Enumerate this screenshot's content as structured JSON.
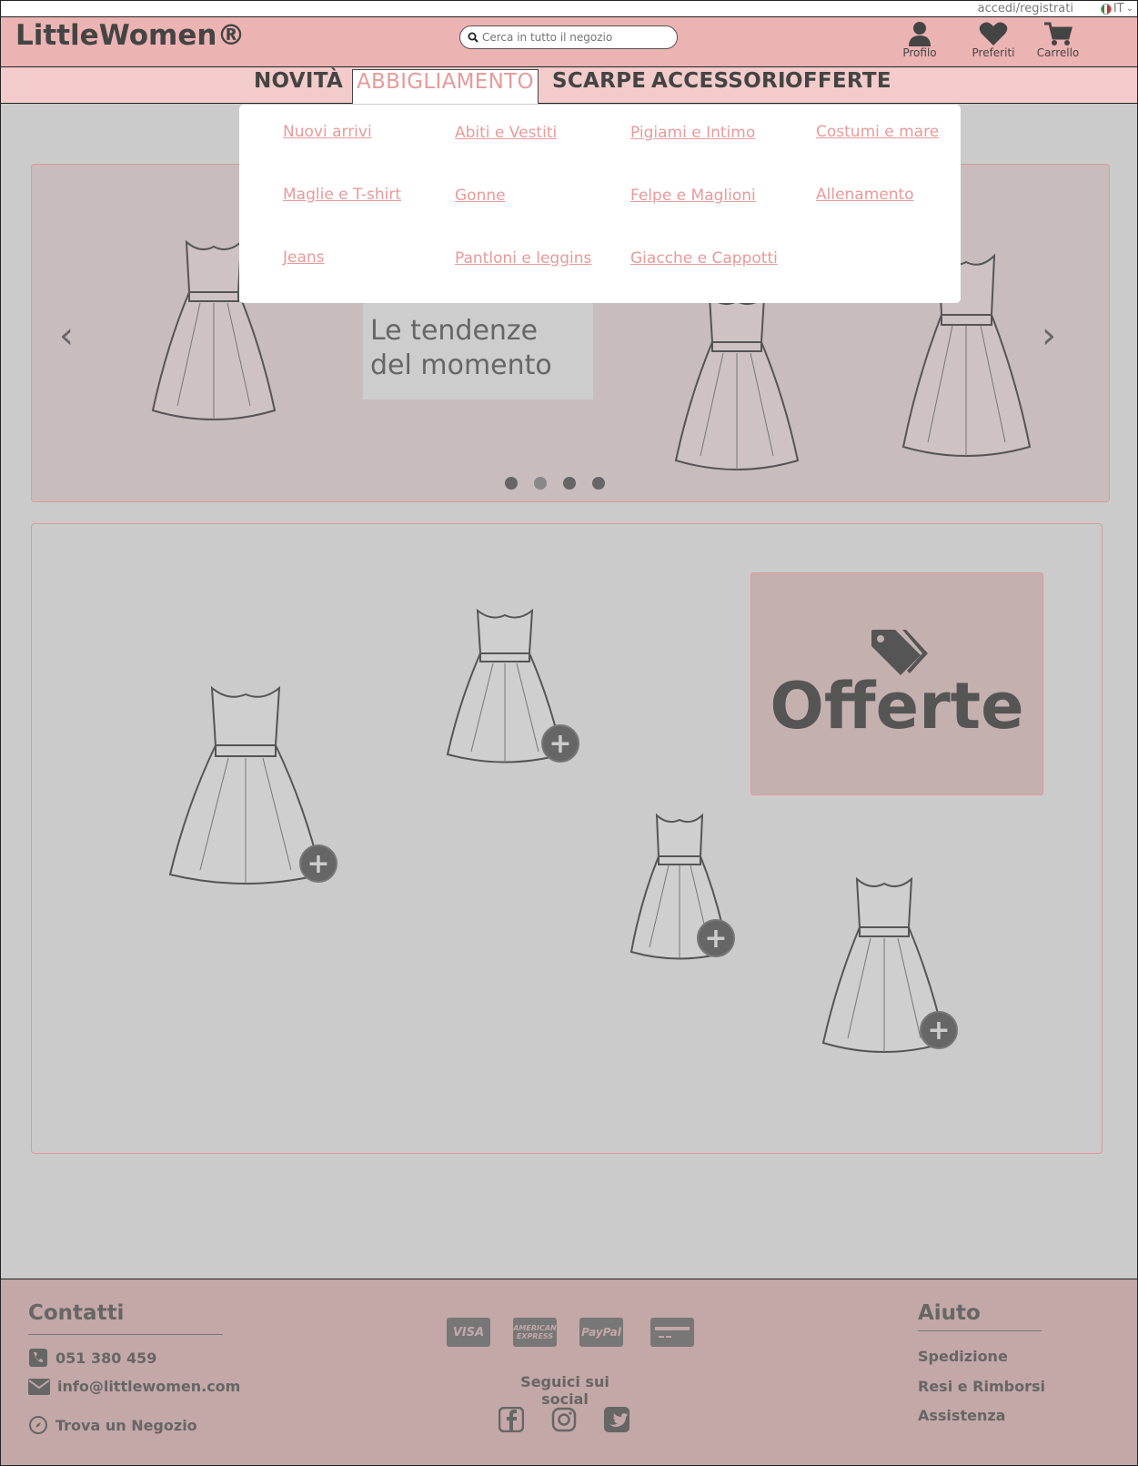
{
  "util": {
    "login": "accedi/registrati",
    "lang": "IT"
  },
  "header": {
    "logo": "LittleWomen®",
    "search_placeholder": "Cerca in tutto il negozio",
    "icons": [
      {
        "name": "user-icon",
        "label": "Profilo"
      },
      {
        "name": "heart-icon",
        "label": "Preferiti"
      },
      {
        "name": "cart-icon",
        "label": "Carrello"
      }
    ]
  },
  "nav": {
    "items": [
      "NOVITÀ",
      "ABBIGLIAMENTO",
      "SCARPE",
      "ACCESSORI",
      "OFFERTE"
    ],
    "active": "ABBIGLIAMENTO"
  },
  "dropdown": {
    "links": [
      "Nuovi arrivi",
      "Abiti e Vestiti",
      "Pigiami e Intimo",
      "Costumi e mare",
      "Maglie e T-shirt",
      "Gonne",
      "Felpe e Maglioni",
      "Allenamento",
      "Jeans",
      "Pantloni e leggins",
      "Giacche e Cappotti"
    ]
  },
  "carousel": {
    "caption_line1": "Le tendenze",
    "caption_line2": "del momento",
    "slides": 4,
    "active_slide": 2
  },
  "offer": {
    "title": "Offerte"
  },
  "footer": {
    "contacts_title": "Contatti",
    "phone": "051 380 459",
    "email": "info@littlewomen.com",
    "store": "Trova un Negozio",
    "cards": [
      "VISA",
      "AMERICAN EXPRESS",
      "PayPal",
      "card"
    ],
    "social_title": "Seguici sui social",
    "help_title": "Aiuto",
    "help_links": [
      "Spedizione",
      "Resi e Rimborsi",
      "Assistenza"
    ]
  },
  "colors": {
    "header_bg": "#ecb3b3",
    "nav_bg": "#f3cbcb",
    "accent": "#e89a9a",
    "footer_bg": "#c4a7a7",
    "page_bg": "#cbcbcb"
  }
}
